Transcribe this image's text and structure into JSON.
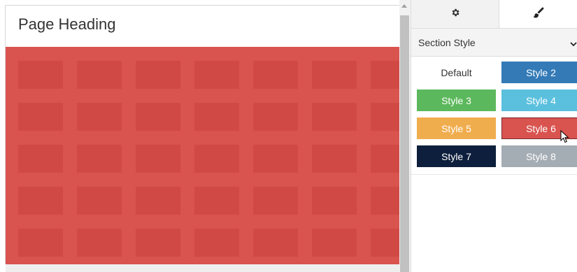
{
  "page": {
    "heading": "Page Heading"
  },
  "colors": {
    "section_bg": "#d9534f",
    "style2": "#337ab7",
    "style3": "#5cb85c",
    "style4": "#5bc0de",
    "style5": "#f0ad4e",
    "style6": "#d9534f",
    "style7": "#0d1f3c",
    "style8": "#a5adb4"
  },
  "panel": {
    "tabs": [
      {
        "icon": "gear-icon",
        "active": false
      },
      {
        "icon": "paint-brush-icon",
        "active": true
      }
    ],
    "section_style": {
      "label": "Section Style",
      "icon": "chevron-down-icon"
    },
    "styles": [
      "Default",
      "Style 2",
      "Style 3",
      "Style 4",
      "Style 5",
      "Style 6",
      "Style 7",
      "Style 8"
    ],
    "hovered_style": "Style 6"
  }
}
